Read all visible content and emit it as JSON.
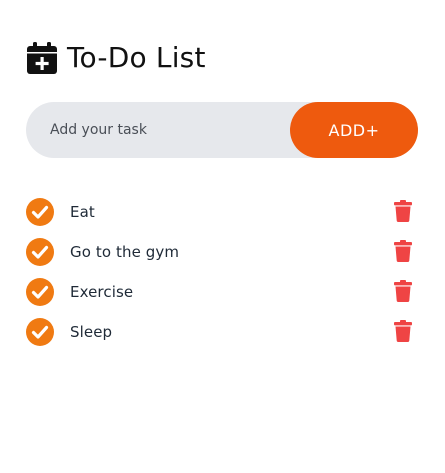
{
  "header": {
    "title": "To-Do List",
    "icon": "calendar-plus-icon"
  },
  "input": {
    "placeholder": "Add your task",
    "value": "",
    "button_label": "ADD+"
  },
  "colors": {
    "accent": "#ee5a0e",
    "check": "#f07a12",
    "trash": "#ef4444",
    "input_bg": "#e6e8ec",
    "text": "#1f2a37"
  },
  "tasks": [
    {
      "label": "Eat",
      "done": true,
      "check_icon": "check-circle-icon",
      "delete_icon": "trash-icon"
    },
    {
      "label": "Go to the gym",
      "done": true,
      "check_icon": "check-circle-icon",
      "delete_icon": "trash-icon"
    },
    {
      "label": "Exercise",
      "done": true,
      "check_icon": "check-circle-icon",
      "delete_icon": "trash-icon"
    },
    {
      "label": "Sleep",
      "done": true,
      "check_icon": "check-circle-icon",
      "delete_icon": "trash-icon"
    }
  ]
}
